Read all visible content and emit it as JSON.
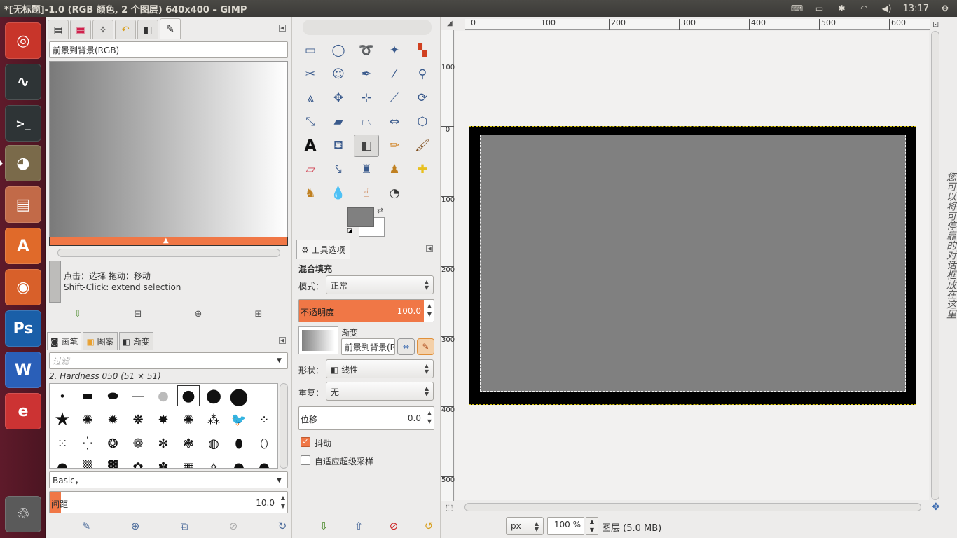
{
  "window": {
    "title": "*[无标题]-1.0 (RGB 颜色, 2 个图层) 640x400 – GIMP"
  },
  "tray": {
    "keyboard": "⌨",
    "battery": "▭",
    "bluetooth": "✱",
    "wifi": "◠",
    "volume": "◀)",
    "time": "13:17",
    "gear": "⚙"
  },
  "launcher": [
    {
      "name": "ubuntu-home",
      "glyph": "◎",
      "color": "#c8352a"
    },
    {
      "name": "system-monitor",
      "glyph": "∿",
      "color": "#2e3436"
    },
    {
      "name": "terminal",
      "glyph": ">_",
      "color": "#2e3436"
    },
    {
      "name": "gimp",
      "glyph": "◕",
      "color": "#7a6a4a"
    },
    {
      "name": "files",
      "glyph": "▤",
      "color": "#c26a48"
    },
    {
      "name": "software-center",
      "glyph": "A",
      "color": "#e06a2a"
    },
    {
      "name": "firefox",
      "glyph": "◉",
      "color": "#d8602a"
    },
    {
      "name": "photoshop",
      "glyph": "Ps",
      "color": "#1a5fa8"
    },
    {
      "name": "wps-writer",
      "glyph": "W",
      "color": "#2a5fb8"
    },
    {
      "name": "wps-office",
      "glyph": "e",
      "color": "#cc3333"
    },
    {
      "name": "trash",
      "glyph": "♲",
      "color": "#5a5a5a"
    }
  ],
  "gradient_editor": {
    "name": "前景到背景(RGB)",
    "hint_line1": "点击：选择   拖动：移动",
    "hint_line2": "Shift-Click: extend selection"
  },
  "brushes": {
    "tabs": [
      "画笔",
      "图案",
      "渐变"
    ],
    "filter_placeholder": "过滤",
    "current": "2. Hardness 050 (51 × 51)",
    "tag": "Basic，",
    "spacing_label": "间距",
    "spacing_value": "10.0"
  },
  "tool_options": {
    "tab": "工具选项",
    "heading": "混合填充",
    "mode_label": "模式：",
    "mode_value": "正常",
    "opacity_label": "不透明度",
    "opacity_value": "100.0",
    "gradient_label": "渐变",
    "gradient_value": "前景到背景(R",
    "shape_label": "形状：",
    "shape_value": "线性",
    "repeat_label": "重复：",
    "repeat_value": "无",
    "offset_label": "位移",
    "offset_value": "0.0",
    "dither_label": "抖动",
    "supersample_label": "自适应超级采样"
  },
  "ruler": {
    "h": [
      "0",
      "100",
      "200",
      "300",
      "400",
      "500",
      "600"
    ],
    "v": [
      "100",
      "0",
      "100",
      "200",
      "300",
      "400",
      "500"
    ]
  },
  "status": {
    "unit": "px",
    "zoom": "100 %",
    "info": "图层 (5.0 MB)"
  },
  "side_text": "您可以将可停靠的对话框放在这里",
  "colors": {
    "accent": "#f07746",
    "fg": "#808080",
    "bg": "#ffffff"
  }
}
